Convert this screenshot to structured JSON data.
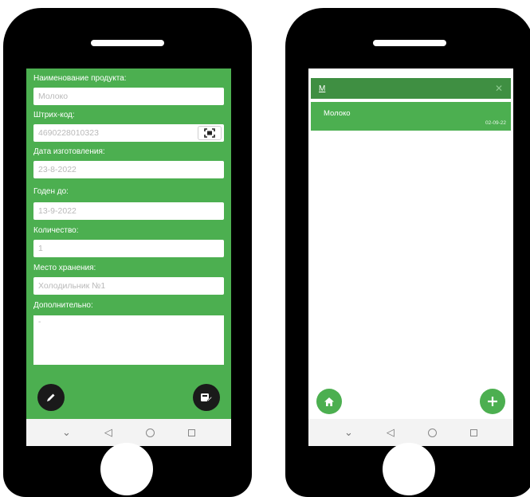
{
  "left_screen": {
    "fields": [
      {
        "label": "Наименование продукта:",
        "value": "Молоко"
      },
      {
        "label": "Штрих-код:",
        "value": "4690228010323"
      },
      {
        "label": "Дата изготовления:",
        "value": "23-8-2022"
      },
      {
        "label": "Годен до:",
        "value": "13-9-2022"
      },
      {
        "label": "Количество:",
        "value": "1"
      },
      {
        "label": "Место хранения:",
        "value": "Холодильник №1"
      }
    ],
    "extra": {
      "label": "Дополнительно:",
      "value": "-"
    },
    "buttons": {
      "edit_icon": "pencil-icon",
      "save_icon": "save-edit-icon"
    }
  },
  "right_screen": {
    "search": {
      "query": "М",
      "clear_icon": "close-icon"
    },
    "items": [
      {
        "name": "Молоко",
        "date": "02-09-22"
      }
    ],
    "buttons": {
      "home_icon": "home-icon",
      "add_icon": "plus-icon"
    }
  },
  "nav": {
    "back_icon": "back-triangle-icon",
    "home_icon": "home-circle-icon",
    "recent_icon": "recent-square-icon",
    "collapse_icon": "chevron-down-icon"
  },
  "colors": {
    "accent": "#4caf50",
    "accent_dark": "#3f8f42",
    "fab_dark": "#1a1a1a"
  }
}
